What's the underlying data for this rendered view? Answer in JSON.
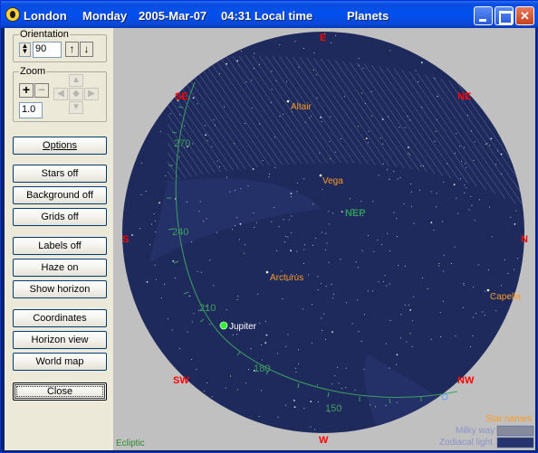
{
  "titlebar": {
    "location": "London",
    "weekday": "Monday",
    "date": "2005-Mar-07",
    "time": "04:31 Local time",
    "view": "Planets"
  },
  "orientation": {
    "label": "Orientation",
    "value": "90"
  },
  "zoom": {
    "label": "Zoom",
    "value": "1.0"
  },
  "buttons": {
    "options": "Options",
    "stars": "Stars off",
    "background": "Background off",
    "grids": "Grids off",
    "labels": "Labels off",
    "haze": "Haze on",
    "horizon": "Show horizon",
    "coordinates": "Coordinates",
    "horizon_view": "Horizon view",
    "world_map": "World map",
    "close": "Close"
  },
  "compass": {
    "E": "E",
    "SE": "SE",
    "NE": "NE",
    "S": "S",
    "N": "N",
    "SW": "SW",
    "NW": "NW",
    "W": "W"
  },
  "stars": {
    "altair": "Altair",
    "vega": "Vega",
    "arcturus": "Arcturus",
    "capella": "Capella"
  },
  "pole": "NEP",
  "planets": {
    "jupiter": "Jupiter"
  },
  "ecliptic": {
    "label": "Ecliptic",
    "ticks": [
      "270",
      "240",
      "210",
      "180",
      "150"
    ]
  },
  "legend": {
    "star_names": "Star names",
    "milky_way": "Milky way",
    "zodiacal_light": "Zodiacal light"
  },
  "colors": {
    "sky": "#1e2a5c",
    "direction": "#ff0000",
    "star_label": "#ff9a22",
    "ecliptic": "#3ea060",
    "jupiter": "#33ee33"
  }
}
